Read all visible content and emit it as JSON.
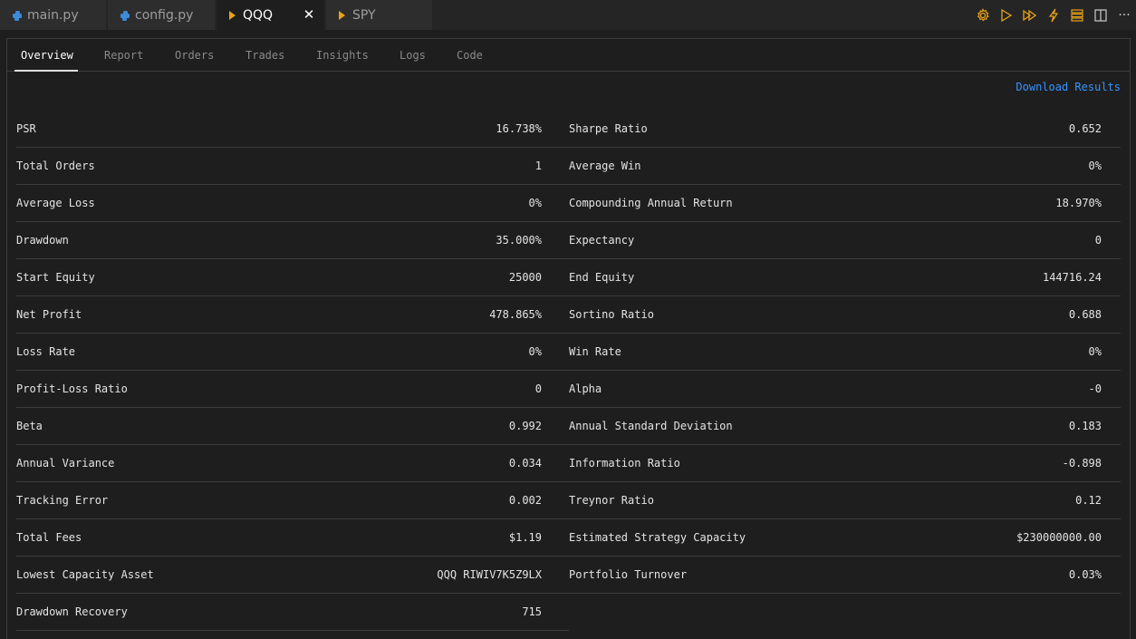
{
  "tabs": [
    {
      "label": "main.py",
      "icon": "python-icon"
    },
    {
      "label": "config.py",
      "icon": "python-icon"
    },
    {
      "label": "QQQ",
      "icon": "play-icon"
    },
    {
      "label": "SPY",
      "icon": "play-icon"
    }
  ],
  "close_glyph": "✕",
  "more_glyph": "···",
  "subtabs": [
    "Overview",
    "Report",
    "Orders",
    "Trades",
    "Insights",
    "Logs",
    "Code"
  ],
  "download_label": "Download Results",
  "stats_left": [
    {
      "label": "PSR",
      "value": "16.738%"
    },
    {
      "label": "Total Orders",
      "value": "1"
    },
    {
      "label": "Average Loss",
      "value": "0%"
    },
    {
      "label": "Drawdown",
      "value": "35.000%"
    },
    {
      "label": "Start Equity",
      "value": "25000"
    },
    {
      "label": "Net Profit",
      "value": "478.865%"
    },
    {
      "label": "Loss Rate",
      "value": "0%"
    },
    {
      "label": "Profit-Loss Ratio",
      "value": "0"
    },
    {
      "label": "Beta",
      "value": "0.992"
    },
    {
      "label": "Annual Variance",
      "value": "0.034"
    },
    {
      "label": "Tracking Error",
      "value": "0.002"
    },
    {
      "label": "Total Fees",
      "value": "$1.19"
    },
    {
      "label": "Lowest Capacity Asset",
      "value": "QQQ RIWIV7K5Z9LX"
    },
    {
      "label": "Drawdown Recovery",
      "value": "715"
    }
  ],
  "stats_right": [
    {
      "label": "Sharpe Ratio",
      "value": "0.652"
    },
    {
      "label": "Average Win",
      "value": "0%"
    },
    {
      "label": "Compounding Annual Return",
      "value": "18.970%"
    },
    {
      "label": "Expectancy",
      "value": "0"
    },
    {
      "label": "End Equity",
      "value": "144716.24"
    },
    {
      "label": "Sortino Ratio",
      "value": "0.688"
    },
    {
      "label": "Win Rate",
      "value": "0%"
    },
    {
      "label": "Alpha",
      "value": "-0"
    },
    {
      "label": "Annual Standard Deviation",
      "value": "0.183"
    },
    {
      "label": "Information Ratio",
      "value": "-0.898"
    },
    {
      "label": "Treynor Ratio",
      "value": "0.12"
    },
    {
      "label": "Estimated Strategy Capacity",
      "value": "$230000000.00"
    },
    {
      "label": "Portfolio Turnover",
      "value": "0.03%"
    }
  ],
  "colors": {
    "accent": "#e8a317",
    "link": "#3794ff",
    "python": "#3c8ad8"
  }
}
